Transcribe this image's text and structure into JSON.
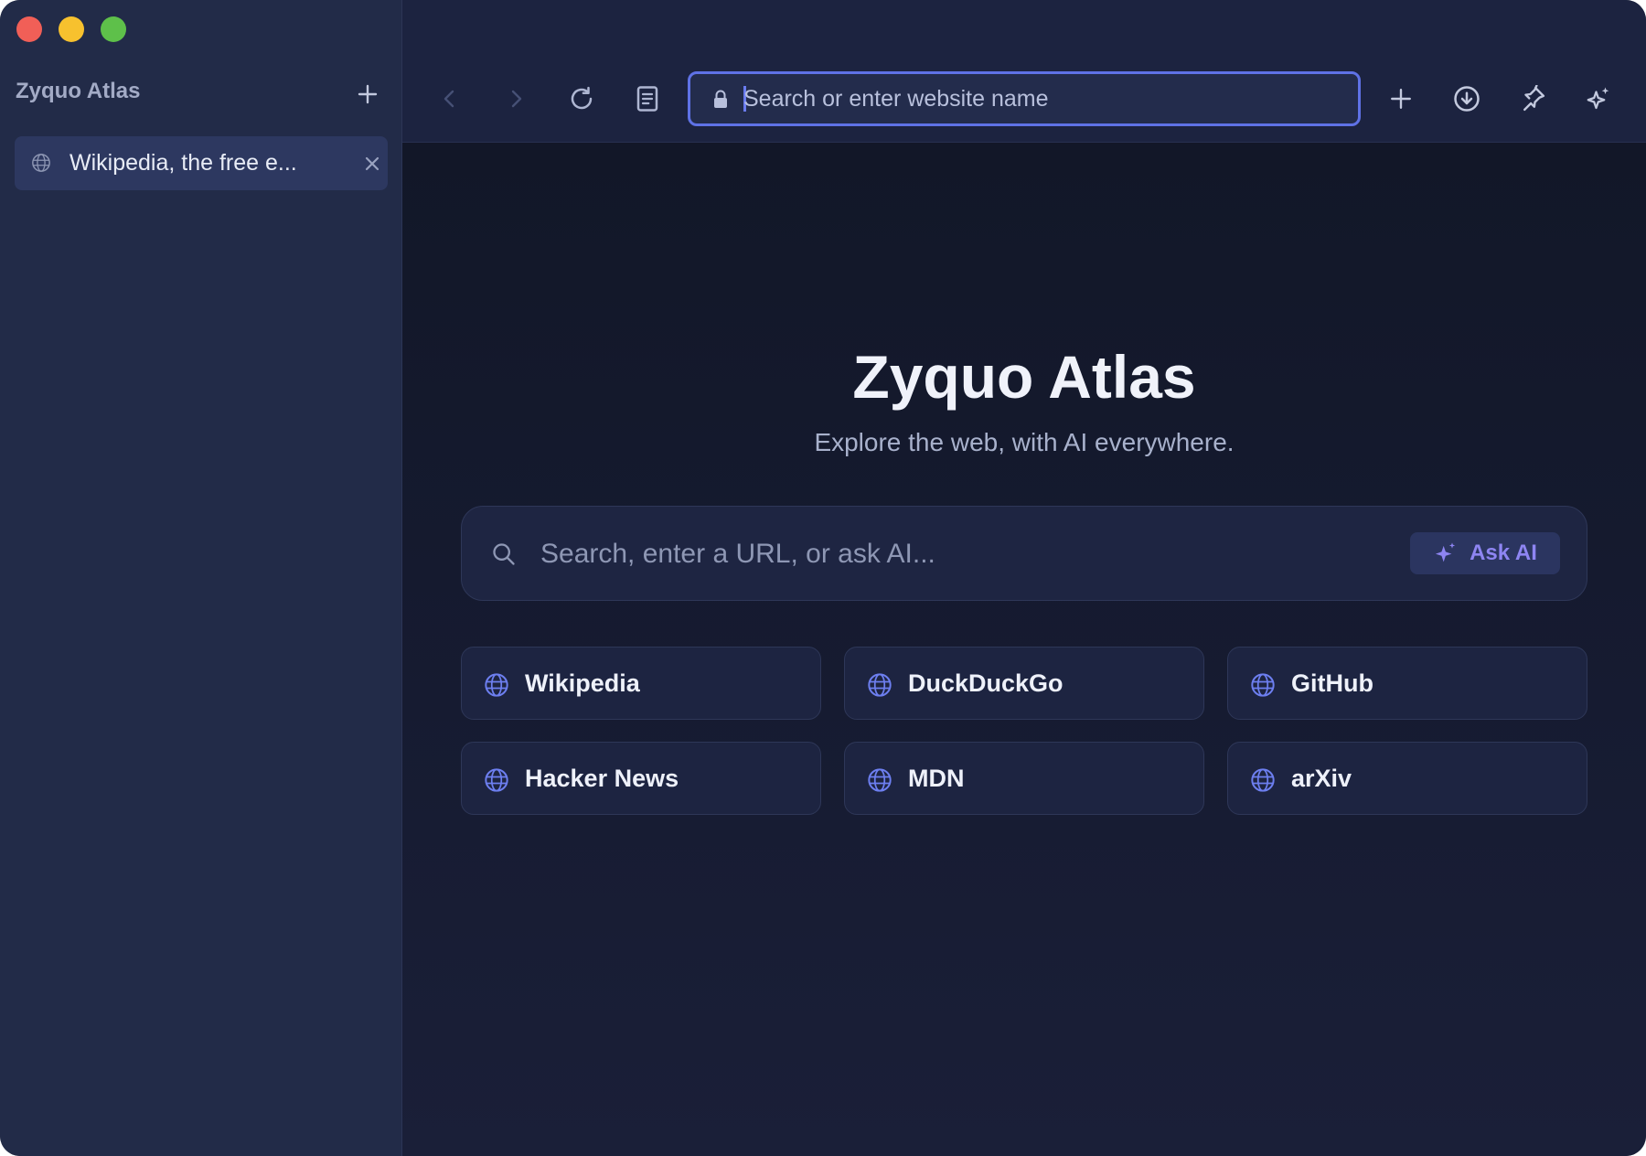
{
  "window": {
    "controls": [
      "close",
      "minimize",
      "maximize"
    ]
  },
  "sidebar": {
    "title": "Zyquo Atlas",
    "add_icon": "plus-icon",
    "tabs": [
      {
        "title": "Wikipedia, the free e...",
        "icon": "globe-icon",
        "close_icon": "close-icon"
      }
    ]
  },
  "toolbar": {
    "buttons": [
      "back-icon",
      "forward-icon",
      "reload-icon",
      "reader-icon",
      "new-tab-icon",
      "download-icon",
      "pin-icon",
      "sparkle-icon"
    ],
    "address_bar": {
      "placeholder": "Search or enter website name",
      "value": "",
      "icon": "lock-icon"
    }
  },
  "content": {
    "title": "Zyquo Atlas",
    "subtitle": "Explore the web, with AI everywhere.",
    "search": {
      "placeholder": "Search, enter a URL, or ask AI...",
      "ask_ai_label": "Ask AI"
    },
    "quick_links": [
      {
        "label": "Wikipedia"
      },
      {
        "label": "DuckDuckGo"
      },
      {
        "label": "GitHub"
      },
      {
        "label": "Hacker News"
      },
      {
        "label": "MDN"
      },
      {
        "label": "arXiv"
      }
    ]
  },
  "colors": {
    "accent": "#5f72e6",
    "ai_accent": "#8e85f2",
    "sidebar_bg": "#222b48",
    "content_bg": "#161a2c"
  }
}
